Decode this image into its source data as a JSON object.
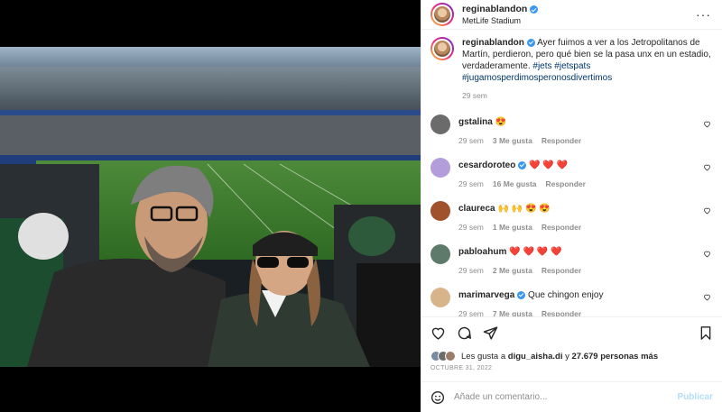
{
  "header": {
    "username": "reginablandon",
    "location": "MetLife Stadium"
  },
  "caption": {
    "username": "reginablandon",
    "text": "Ayer fuimos a ver a los Jetropolitanos de Martín, perdieron, pero qué bien se la pasa unx en un estadio, verdaderamente.",
    "hashtags": [
      "#jets",
      "#jetspats",
      "#jugamosperdimosperonosdivertimos"
    ],
    "time": "29 sem"
  },
  "comments": [
    {
      "username": "gstalina",
      "text": "😍",
      "time": "29 sem",
      "likes": "3 Me gusta",
      "reply": "Responder",
      "verified": false,
      "avatar_color": "#6b6b6b"
    },
    {
      "username": "cesardoroteo",
      "text": "❤️ ❤️ ❤️",
      "time": "29 sem",
      "likes": "16 Me gusta",
      "reply": "Responder",
      "verified": true,
      "avatar_color": "#b39ddb"
    },
    {
      "username": "claureca",
      "text": "🙌 🙌 😍 😍",
      "time": "29 sem",
      "likes": "1 Me gusta",
      "reply": "Responder",
      "verified": false,
      "avatar_color": "#a0522d"
    },
    {
      "username": "pabloahum",
      "text": "❤️ ❤️ ❤️ ❤️",
      "time": "29 sem",
      "likes": "2 Me gusta",
      "reply": "Responder",
      "verified": false,
      "avatar_color": "#5d7a6a"
    },
    {
      "username": "marimarvega",
      "text": "Que chingon enjoy",
      "time": "29 sem",
      "likes": "7 Me gusta",
      "reply": "Responder",
      "verified": true,
      "avatar_color": "#d8b48a"
    }
  ],
  "likes": {
    "prefix": "Les gusta a",
    "first_user": "digu_aisha.di",
    "conj": "y",
    "count": "27.679 personas más"
  },
  "date": "OCTUBRE 31, 2022",
  "composer": {
    "placeholder": "Añade un comentario...",
    "post_label": "Publicar"
  },
  "colors": {
    "link": "#00376b",
    "verified": "#3897f0",
    "muted": "#8e8e8e",
    "post_disabled": "#b2dffc"
  }
}
